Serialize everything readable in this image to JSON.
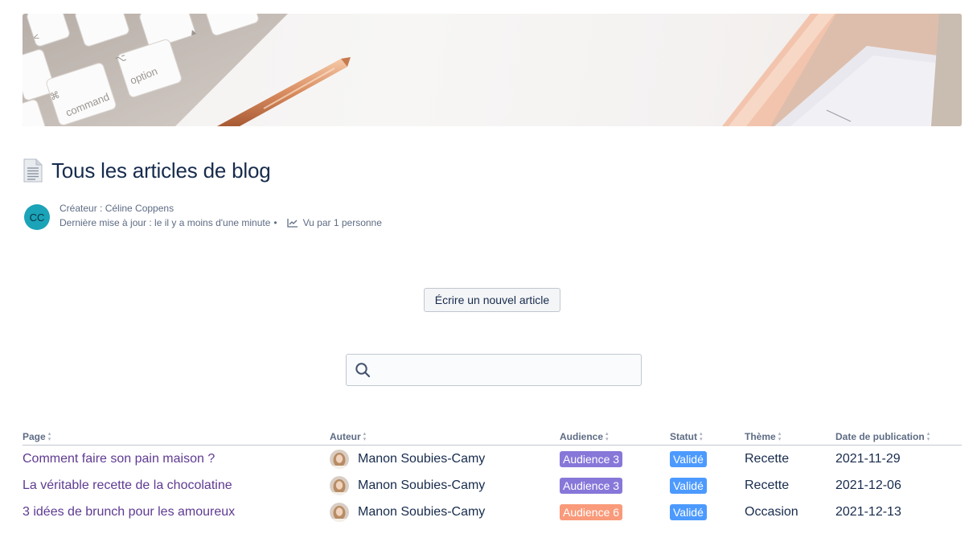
{
  "page": {
    "title": "Tous les articles de blog",
    "creator": "Créateur : Céline Coppens",
    "updated": "Dernière mise à jour : le il y a moins d'une minute",
    "dot": "•",
    "views": "Vu par 1 personne",
    "avatar_initials": "CC"
  },
  "actions": {
    "new_article": "Écrire un nouvel article"
  },
  "search": {
    "placeholder": "",
    "value": ""
  },
  "banner": {
    "keys": [
      "command",
      "option"
    ]
  },
  "table": {
    "headers": [
      "Page",
      "Auteur",
      "Audience",
      "Statut",
      "Thème",
      "Date de publication"
    ],
    "rows": [
      {
        "page": "Comment faire son pain maison ?",
        "author": "Manon Soubies-Camy",
        "audience": "Audience 3",
        "audience_color": "#8777d9",
        "status": "Validé",
        "status_color": "#4c9aff",
        "theme": "Recette",
        "date": "2021-11-29"
      },
      {
        "page": "La véritable recette de la chocolatine",
        "author": "Manon Soubies-Camy",
        "audience": "Audience 3",
        "audience_color": "#8777d9",
        "status": "Validé",
        "status_color": "#4c9aff",
        "theme": "Recette",
        "date": "2021-12-06"
      },
      {
        "page": "3 idées de brunch pour les amoureux",
        "author": "Manon Soubies-Camy",
        "audience": "Audience 6",
        "audience_color": "#f99a7a",
        "status": "Validé",
        "status_color": "#4c9aff",
        "theme": "Occasion",
        "date": "2021-12-13"
      }
    ]
  },
  "colors": {
    "link": "#5e3a92",
    "avatar": "#1ba3b8"
  }
}
